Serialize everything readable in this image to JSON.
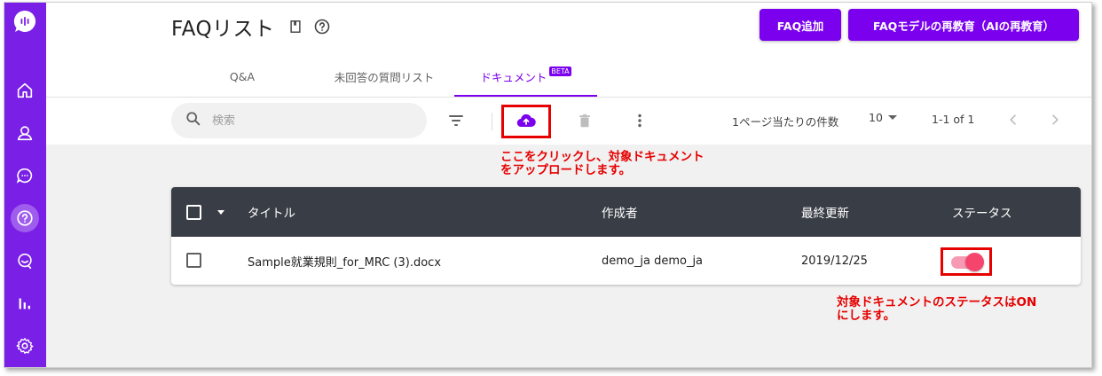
{
  "header": {
    "title": "FAQリスト",
    "add_button": "FAQ追加",
    "retrain_button": "FAQモデルの再教育（AIの再教育）"
  },
  "sidebar": {
    "items": [
      {
        "icon": "home-icon"
      },
      {
        "icon": "user-icon"
      },
      {
        "icon": "chat-icon"
      },
      {
        "icon": "faq-icon",
        "active": true
      },
      {
        "icon": "conversation-icon"
      },
      {
        "icon": "analytics-icon"
      },
      {
        "icon": "settings-icon"
      }
    ]
  },
  "tabs": [
    {
      "label": "Q&A"
    },
    {
      "label": "未回答の質問リスト"
    },
    {
      "label": "ドキュメント",
      "badge": "BETA",
      "active": true
    }
  ],
  "toolbar": {
    "search_placeholder": "検索",
    "rows_per_page_label": "1ページ当たりの件数",
    "rows_per_page_value": "10",
    "page_range": "1-1 of 1"
  },
  "annotations": {
    "upload_line1": "ここをクリックし、対象ドキュメント",
    "upload_line2": "をアップロードします。",
    "status_line1": "対象ドキュメントのステータスはON",
    "status_line2": "にします。"
  },
  "table": {
    "columns": [
      "タイトル",
      "作成者",
      "最終更新",
      "ステータス"
    ],
    "rows": [
      {
        "title": "Sample就業規則_for_MRC (3).docx",
        "author": "demo_ja demo_ja",
        "updated": "2019/12/25",
        "status": "on"
      }
    ]
  },
  "colors": {
    "brand": "#7a1fe6",
    "primary_button": "#7a00ee",
    "annotation": "#e60000",
    "table_header": "#393e46",
    "toggle_on": "#f5456d"
  }
}
